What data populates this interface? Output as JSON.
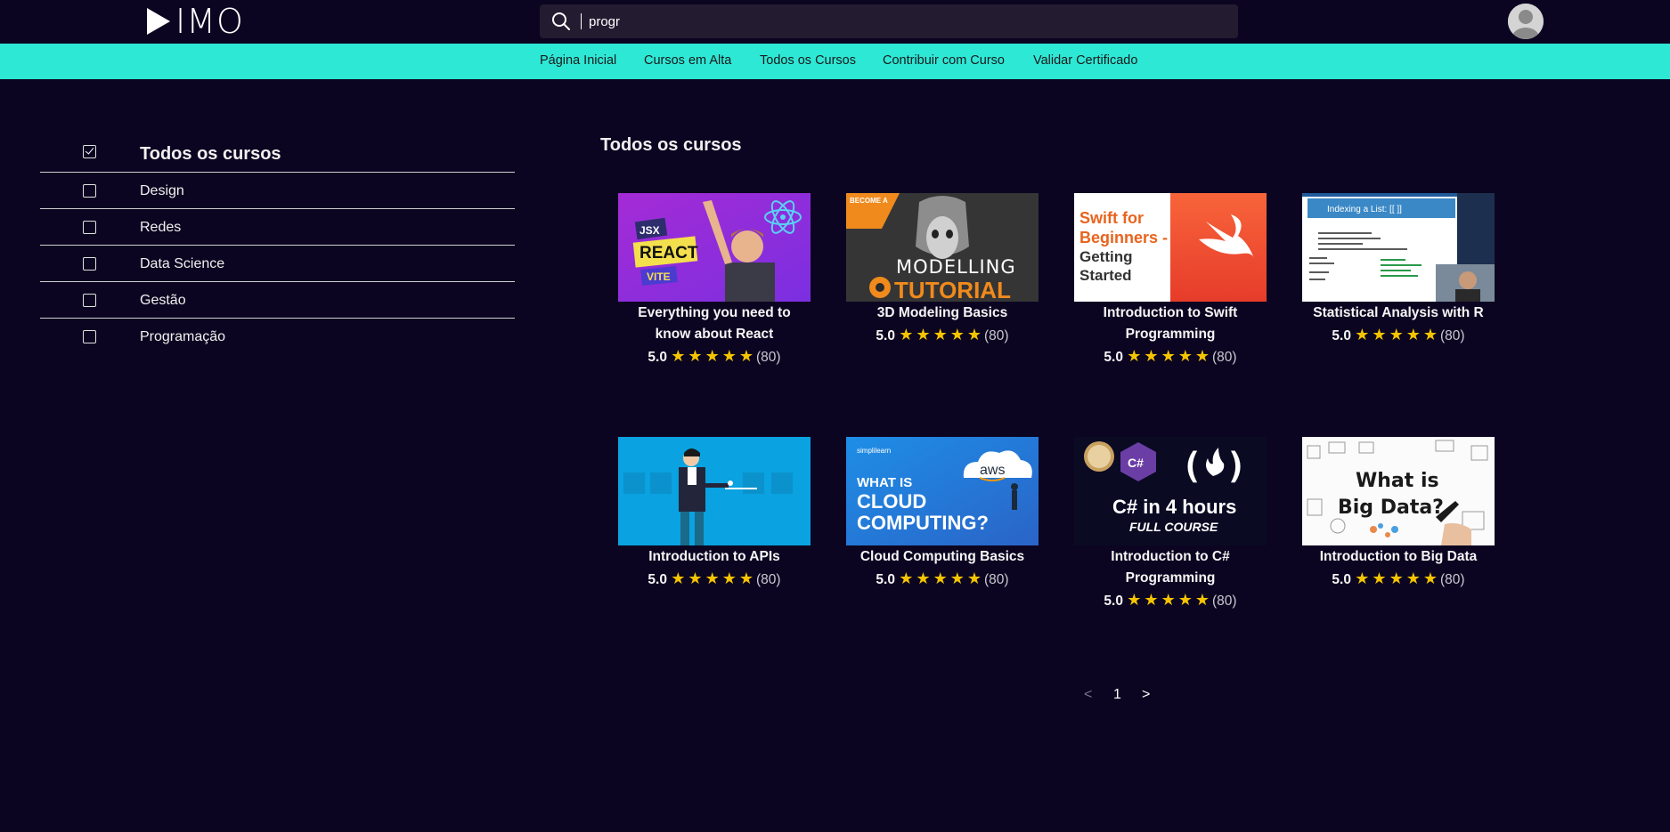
{
  "header": {
    "logo_text": "IMO",
    "search": {
      "value": "progr"
    }
  },
  "nav": {
    "items": [
      {
        "label": "Página Inicial"
      },
      {
        "label": "Cursos em Alta"
      },
      {
        "label": "Todos os Cursos"
      },
      {
        "label": "Contribuir com Curso"
      },
      {
        "label": "Validar Certificado"
      }
    ]
  },
  "sidebar": {
    "categories": [
      {
        "label": "Todos os cursos",
        "checked": true
      },
      {
        "label": "Design",
        "checked": false
      },
      {
        "label": "Redes",
        "checked": false
      },
      {
        "label": "Data Science",
        "checked": false
      },
      {
        "label": "Gestão",
        "checked": false
      },
      {
        "label": "Programação",
        "checked": false
      }
    ]
  },
  "main": {
    "title": "Todos os cursos",
    "courses": [
      {
        "title": "Everything you need to know about React",
        "score": "5.0",
        "count": "(80)",
        "thumb_text": [
          "JSX",
          "REACT",
          "VITE"
        ]
      },
      {
        "title": "3D Modeling Basics",
        "score": "5.0",
        "count": "(80)",
        "thumb_text": [
          "BECOME A",
          "MODELLING",
          "TUTORIAL"
        ]
      },
      {
        "title": "Introduction to Swift Programming",
        "score": "5.0",
        "count": "(80)",
        "thumb_text": [
          "Swift for",
          "Beginners -",
          "Getting",
          "Started"
        ]
      },
      {
        "title": "Statistical Analysis with R",
        "score": "5.0",
        "count": "(80)",
        "thumb_text": [
          "Indexing a List: [[ ]]"
        ]
      },
      {
        "title": "Introduction to APIs",
        "score": "5.0",
        "count": "(80)",
        "thumb_text": []
      },
      {
        "title": "Cloud Computing Basics",
        "score": "5.0",
        "count": "(80)",
        "thumb_text": [
          "simplilearn",
          "WHAT IS",
          "CLOUD",
          "COMPUTING?",
          "aws"
        ]
      },
      {
        "title": "Introduction to C# Programming",
        "score": "5.0",
        "count": "(80)",
        "thumb_text": [
          "C#",
          "C# in 4 hours",
          "FULL COURSE"
        ]
      },
      {
        "title": "Introduction to Big Data",
        "score": "5.0",
        "count": "(80)",
        "thumb_text": [
          "What is",
          "Big Data?"
        ]
      }
    ],
    "stars": "★★★★★"
  },
  "pagination": {
    "prev": "<",
    "current": "1",
    "next": ">"
  },
  "colors": {
    "background": "#0c0521",
    "nav": "#2ee8d6",
    "star": "#f5c400"
  }
}
